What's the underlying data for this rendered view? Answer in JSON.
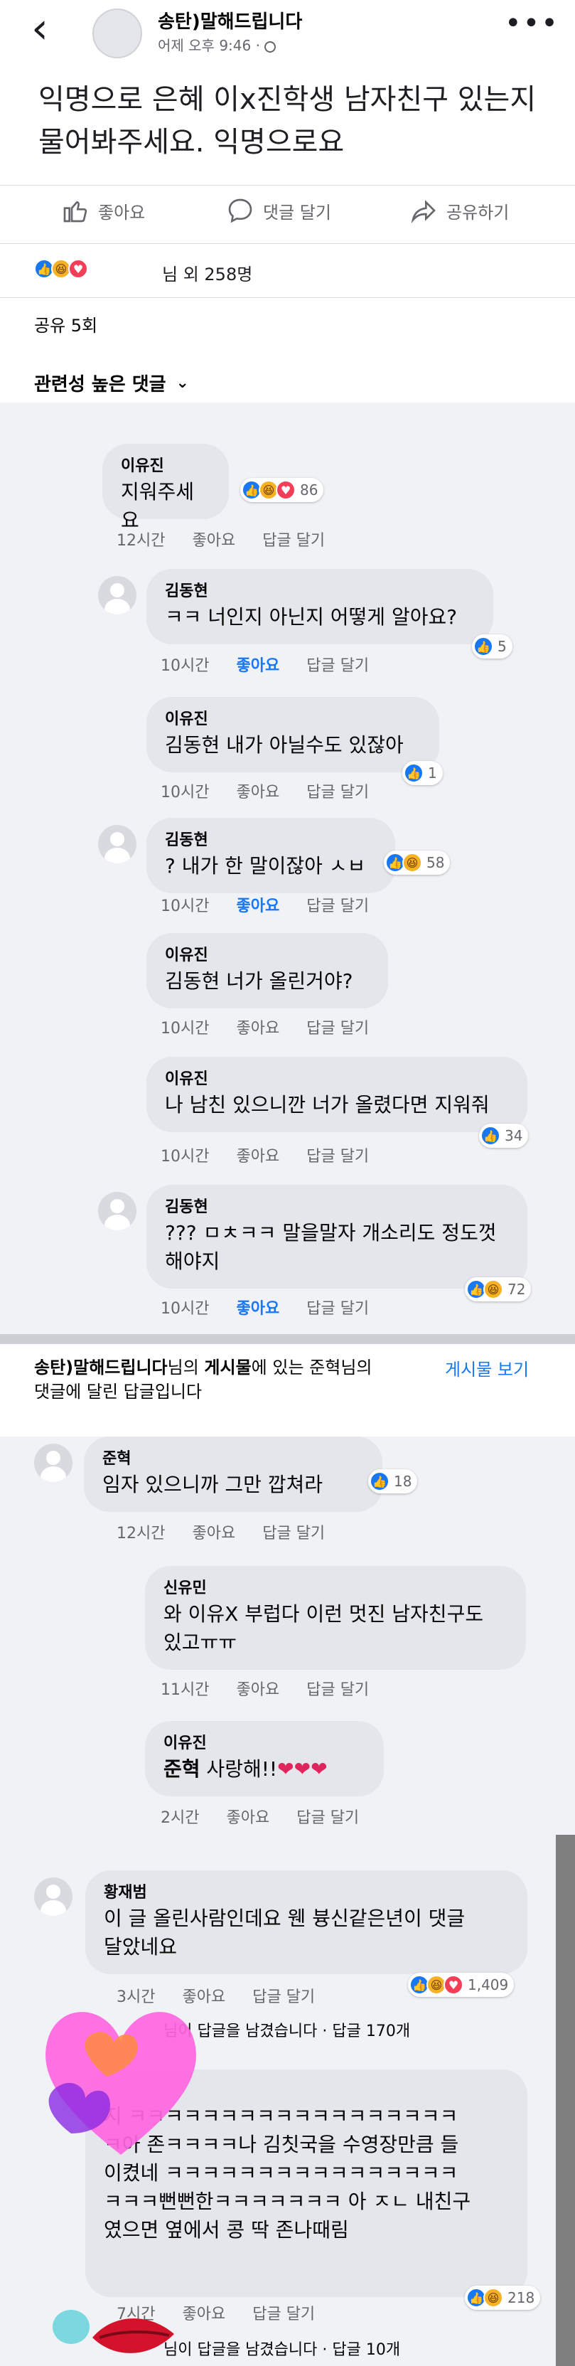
{
  "header": {
    "back_icon": "chevron-left-icon",
    "page_name": "송탄)말해드립니다",
    "post_time": "어제 오후 9:46 · ",
    "more_icon": "ellipsis-icon"
  },
  "post": {
    "text": "익명으로 은혜 이x진학생 남자친구 있는지 물어봐주세요. 익명으로요",
    "actions": {
      "like": "좋아요",
      "comment": "댓글 달기",
      "share": "공유하기"
    },
    "reaction_summary": "님 외 258명",
    "share_count": "공유 5회",
    "sort_label": "관련성 높은 댓글"
  },
  "comments": [
    {
      "name": "이유진",
      "text": "지워주세요",
      "time": "12시간",
      "like": "좋아요",
      "reply": "답글 달기",
      "reactions": "86",
      "liked": false
    },
    {
      "name": "김동현",
      "text": "ㅋㅋ 너인지 아닌지 어떻게 알아요?",
      "time": "10시간",
      "like": "좋아요",
      "reply": "답글 달기",
      "reactions": "5",
      "liked": true
    },
    {
      "name": "이유진",
      "text": "김동현 내가 아닐수도 있잖아",
      "time": "10시간",
      "like": "좋아요",
      "reply": "답글 달기",
      "reactions": "1",
      "liked": false
    },
    {
      "name": "김동현",
      "text": "? 내가 한 말이잖아 ㅅㅂ",
      "time": "10시간",
      "like": "좋아요",
      "reply": "답글 달기",
      "reactions": "58",
      "liked": true
    },
    {
      "name": "이유진",
      "text": "김동현 너가 올린거야?",
      "time": "10시간",
      "like": "좋아요",
      "reply": "답글 달기",
      "reactions": "",
      "liked": false
    },
    {
      "name": "이유진",
      "text": "나 남친 있으니깐 너가 올렸다면 지워줘",
      "time": "10시간",
      "like": "좋아요",
      "reply": "답글 달기",
      "reactions": "34",
      "liked": false
    },
    {
      "name": "김동현",
      "text1": "??? ㅁㅊㅋㅋ 말을말자 개소리도 정도껏",
      "text2": "해야지",
      "time": "10시간",
      "like": "좋아요",
      "reply": "답글 달기",
      "reactions": "72",
      "liked": true
    }
  ],
  "notice": {
    "part1": "송탄)말해드립니다",
    "part2": "님의 ",
    "part3": "게시물",
    "part4": "에 있는 준혁님의",
    "line2": "댓글에 달린 답글입니다",
    "link": "게시물 보기"
  },
  "thread2": [
    {
      "name": "준혁",
      "text": "임자 있으니까 그만 깝쳐라",
      "time": "12시간",
      "like": "좋아요",
      "reply": "답글 달기",
      "reactions": "18"
    },
    {
      "name": "신유민",
      "text1": "와 이유X 부럽다 이런 멋진 남자친구도",
      "text2": "있고ㅠㅠ",
      "time": "11시간",
      "like": "좋아요",
      "reply": "답글 달기"
    },
    {
      "name": "이유진",
      "mention": "준혁",
      "text": " 사랑해!!",
      "time": "2시간",
      "like": "좋아요",
      "reply": "답글 달기"
    }
  ],
  "thread3": [
    {
      "name": "황재범",
      "text1": "이 글 올린사람인데요 웬 븅신같은년이 댓글",
      "text2": "달았네요",
      "time": "3시간",
      "like": "좋아요",
      "reply": "답글 달기",
      "reactions": "1,409",
      "replies_note": "님이 답글을 남겼습니다 · 답글 170개"
    },
    {
      "name": "",
      "lines": [
        "지 ㅋㅋㅋㅋㅋㅋㅋㅋㅋㅋㅋㅋㅋㅋㅋㅋㅋㅋ",
        "ㅋ아 존ㅋㅋㅋㅋ나 김칫국을 수영장만큼 들",
        "이켰네 ㅋㅋㅋㅋㅋㅋㅋㅋㅋㅋㅋㅋㅋㅋㅋㅋ",
        "ㅋㅋㅋ뻔뻔한ㅋㅋㅋㅋㅋㅋㅋ 아 ㅈㄴ 내친구",
        "였으면 옆에서 콩 딱 존나때림"
      ],
      "time": "7시간",
      "like": "좋아요",
      "reply": "답글 달기",
      "reactions": "218",
      "replies_note": "님이 답글을 남겼습니다 · 답글 10개"
    }
  ]
}
